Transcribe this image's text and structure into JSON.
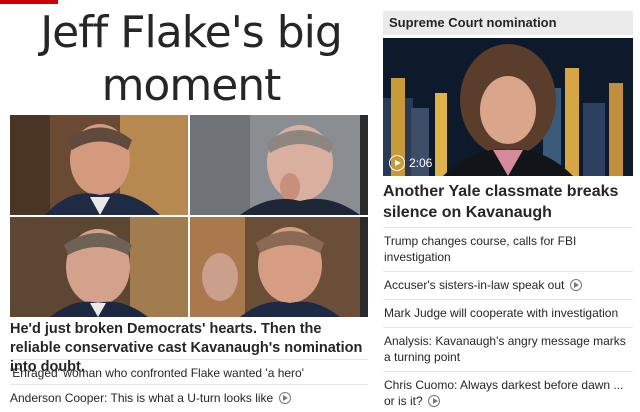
{
  "main_story": {
    "headline": "Jeff Flake's big moment",
    "dek": "He'd just broken Democrats' hearts. Then the reliable conservative cast Kavanaugh's nomination into doubt.",
    "related": [
      {
        "label": "'Enraged' woman who confronted Flake wanted 'a hero'",
        "video": false
      },
      {
        "label": "Anderson Cooper: This is what a U-turn looks like",
        "video": true
      }
    ]
  },
  "sidebar": {
    "section_title": "Supreme Court nomination",
    "video_duration": "2:06",
    "video_headline": "Another Yale classmate breaks silence on Kavanaugh",
    "items": [
      {
        "label": "Trump changes course, calls for FBI investigation",
        "video": false
      },
      {
        "label": "Accuser's sisters-in-law speak out",
        "video": true
      },
      {
        "label": "Mark Judge will cooperate with investigation",
        "video": false
      },
      {
        "label": "Analysis: Kavanaugh's angry message marks a turning point",
        "video": false
      },
      {
        "label": "Chris Cuomo: Always darkest before dawn ... or is it?",
        "video": true
      }
    ]
  },
  "colors": {
    "brand_red": "#cc0000",
    "text": "#262626",
    "section_bg": "#ebebeb",
    "divider": "#e6e6e6"
  },
  "icons": {
    "video": "play-circle-icon"
  }
}
